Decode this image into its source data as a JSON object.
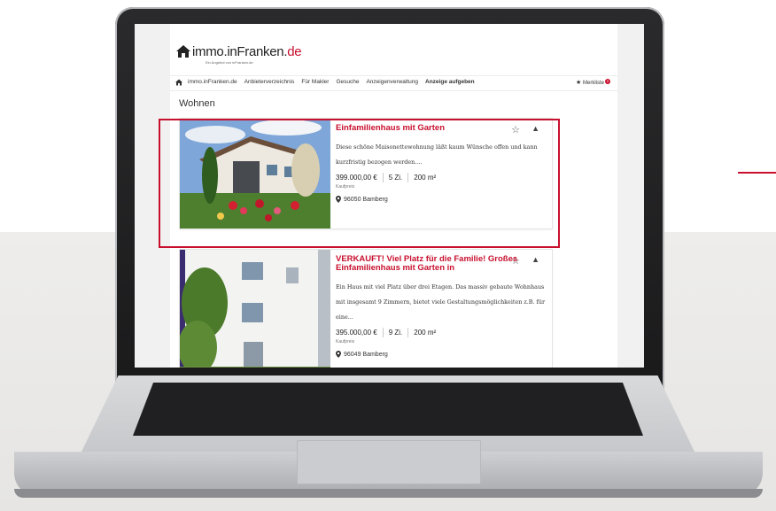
{
  "site": {
    "logo_text": "immo.inFranken",
    "logo_tld": "de",
    "logo_tagline": "Ein Angebot von inFranken.de"
  },
  "nav": {
    "items": [
      "immo.inFranken.de",
      "Anbieterverzeichnis",
      "Für Makler",
      "Gesuche",
      "Anzeigenverwaltung",
      "Anzeige aufgeben"
    ],
    "merkliste": "Merkliste",
    "merkliste_count": "0"
  },
  "section_title": "Wohnen",
  "listings": [
    {
      "title": "Einfamilienhaus mit Garten",
      "description": "Diese schöne Maisonettewohnung läßt kaum Wünsche offen und kann kurzfristig bezogen werden....",
      "price": "399.000,00 €",
      "rooms": "5 Zi.",
      "area": "200 m²",
      "price_label": "Kaufpreis",
      "location": "96050 Bamberg"
    },
    {
      "title": "VERKAUFT! Viel Platz für die Familie! Großes Einfamilienhaus mit Garten in",
      "description": "Ein Haus mit viel Platz über drei Etagen. Das massiv gebaute Wohnhaus mit insgesamt 9 Zimmern, bietet viele Gestaltungsmöglichkeiten z.B. für eine...",
      "price": "395.000,00 €",
      "rooms": "9 Zi.",
      "area": "200 m²",
      "price_label": "Kaufpreis",
      "location": "96049 Bamberg"
    }
  ],
  "colors": {
    "accent": "#c8102e",
    "laptop_bezel": "#1a1a1b",
    "laptop_body": "#c7c8cb"
  },
  "icons": [
    "home-icon",
    "star-icon",
    "chevron-up-icon",
    "location-pin-icon"
  ]
}
